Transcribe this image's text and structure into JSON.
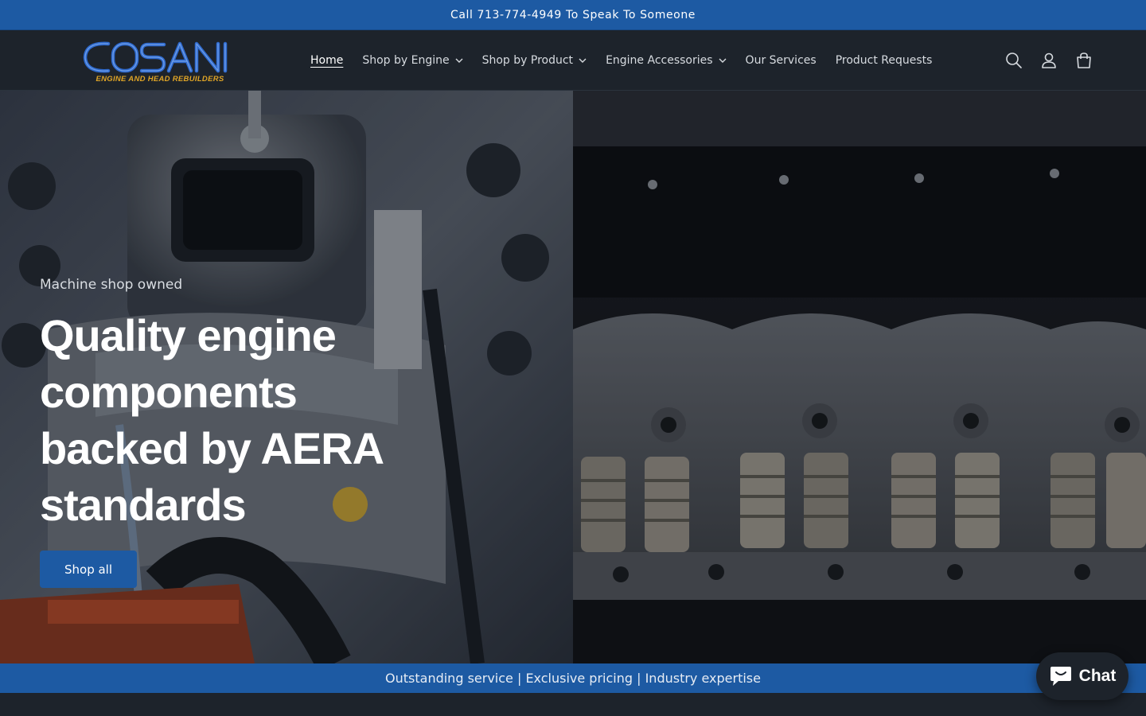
{
  "announcement": "Call 713-774-4949 To Speak To Someone",
  "brand": {
    "name": "COSANI",
    "tagline": "ENGINE AND HEAD REBUILDERS",
    "primary_color": "#1d5aa3",
    "tagline_color": "#e0a526",
    "header_bg": "#1d232b"
  },
  "nav": {
    "items": [
      {
        "label": "Home",
        "active": true,
        "dropdown": false
      },
      {
        "label": "Shop by Engine",
        "active": false,
        "dropdown": true
      },
      {
        "label": "Shop by Product",
        "active": false,
        "dropdown": true
      },
      {
        "label": "Engine Accessories",
        "active": false,
        "dropdown": true
      },
      {
        "label": "Our Services",
        "active": false,
        "dropdown": false
      },
      {
        "label": "Product Requests",
        "active": false,
        "dropdown": false
      }
    ]
  },
  "header_icons": [
    "search-icon",
    "account-icon",
    "cart-icon"
  ],
  "hero": {
    "subheading": "Machine shop owned",
    "title_line1": "Quality engine components",
    "title_line2": "backed by AERA standards",
    "button_label": "Shop all"
  },
  "ticker": "Outstanding service | Exclusive pricing | Industry expertise",
  "chat": {
    "label": "Chat"
  }
}
